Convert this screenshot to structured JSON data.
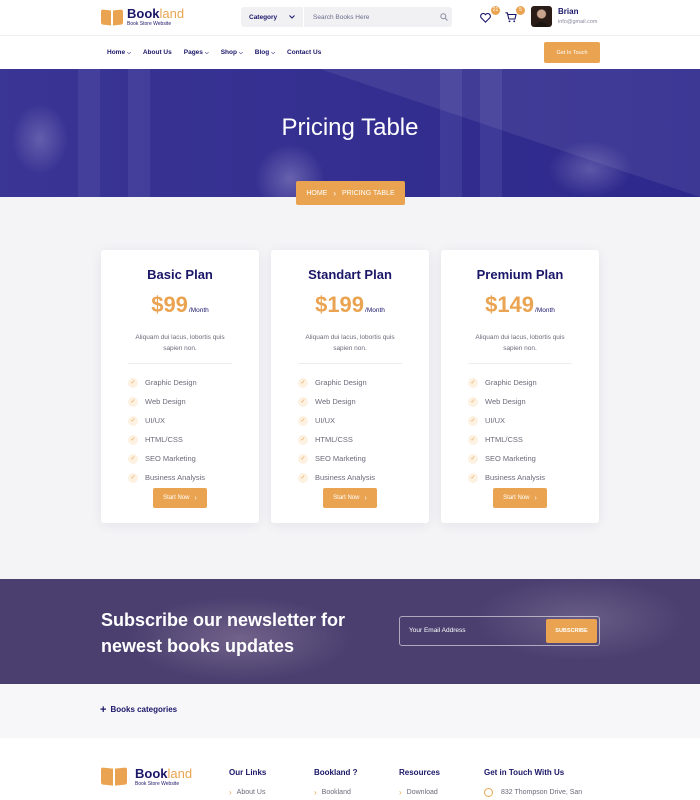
{
  "header": {
    "logo_main": "Book",
    "logo_accent": "land",
    "logo_tagline": "Book Store Website",
    "search_category": "Category",
    "search_placeholder": "Search Books Here",
    "wishlist_count": "21",
    "cart_count": "5",
    "user_name": "Brian",
    "user_email": "info@gmail.com"
  },
  "nav": {
    "items": [
      {
        "label": "Home",
        "has_dropdown": true
      },
      {
        "label": "About Us",
        "has_dropdown": false
      },
      {
        "label": "Pages",
        "has_dropdown": true
      },
      {
        "label": "Shop",
        "has_dropdown": true
      },
      {
        "label": "Blog",
        "has_dropdown": true
      },
      {
        "label": "Contact Us",
        "has_dropdown": false
      }
    ],
    "cta_label": "Get In Touch"
  },
  "hero": {
    "title": "Pricing Table",
    "breadcrumb_home": "HOME",
    "breadcrumb_current": "PRICING TABLE"
  },
  "plans": [
    {
      "name": "Basic Plan",
      "price": "$99",
      "period": "/Month",
      "description": "Aliquam dui lacus, lobortis quis sapien non.",
      "features": [
        "Graphic Design",
        "Web Design",
        "UI/UX",
        "HTML/CSS",
        "SEO Marketing",
        "Business Analysis"
      ],
      "button": "Start Now"
    },
    {
      "name": "Standart Plan",
      "price": "$199",
      "period": "/Month",
      "description": "Aliquam dui lacus, lobortis quis sapien non.",
      "features": [
        "Graphic Design",
        "Web Design",
        "UI/UX",
        "HTML/CSS",
        "SEO Marketing",
        "Business Analysis"
      ],
      "button": "Start Now"
    },
    {
      "name": "Premium Plan",
      "price": "$149",
      "period": "/Month",
      "description": "Aliquam dui lacus, lobortis quis sapien non.",
      "features": [
        "Graphic Design",
        "Web Design",
        "UI/UX",
        "HTML/CSS",
        "SEO Marketing",
        "Business Analysis"
      ],
      "button": "Start Now"
    }
  ],
  "newsletter": {
    "heading": "Subscribe our newsletter for newest books updates",
    "placeholder": "Your Email Address",
    "button": "SUBSCRIBE"
  },
  "categories": {
    "label": "Books categories"
  },
  "footer": {
    "logo_main": "Book",
    "logo_accent": "land",
    "logo_tagline": "Book Store Website",
    "columns": [
      {
        "heading": "Our Links",
        "first_item": "About Us"
      },
      {
        "heading": "Bookland ?",
        "first_item": "Bookland"
      },
      {
        "heading": "Resources",
        "first_item": "Download"
      },
      {
        "heading": "Get in Touch With Us",
        "first_item": "832 Thompson Drive, San"
      }
    ]
  },
  "colors": {
    "primary": "#1a1668",
    "accent": "#eaa451"
  },
  "icons": [
    "heart-icon",
    "cart-icon",
    "search-icon",
    "chevron-down-icon",
    "check-icon",
    "arrow-right-icon",
    "plus-icon",
    "location-pin-icon"
  ]
}
